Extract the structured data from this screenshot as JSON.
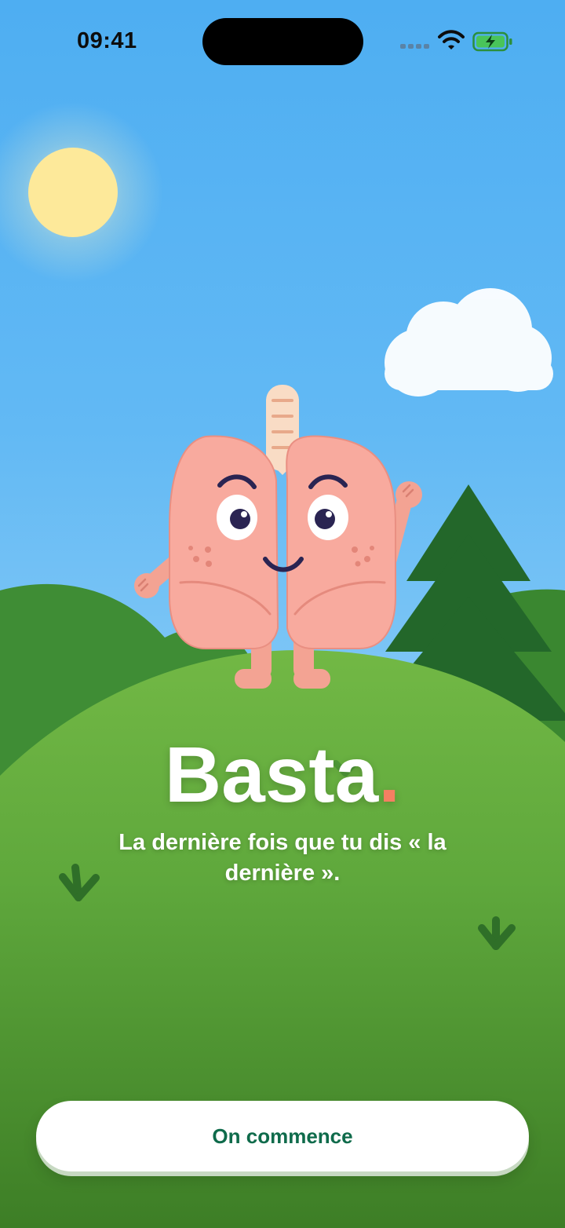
{
  "status_bar": {
    "time": "09:41",
    "icons": [
      "cellular-signal-icon",
      "wifi-icon",
      "battery-charging-icon"
    ]
  },
  "illustration": {
    "elements": [
      "sun",
      "cloud",
      "hills",
      "pine-tree",
      "lungs-mascot",
      "grass-tufts"
    ],
    "mascot": "smiling-lungs-character-waving"
  },
  "brand": {
    "name": "Basta",
    "dot": "."
  },
  "tagline": "La dernière fois que tu dis « la dernière ».",
  "cta": {
    "label": "On commence"
  },
  "colors": {
    "sky_top": "#4eaef2",
    "sky_bottom": "#9dd3f5",
    "sun": "#fde99a",
    "hill_front": "#6ab344",
    "hill_back": "#3a8a34",
    "tree": "#23672a",
    "lungs": "#f8aa9e",
    "accent_dot": "#f47f62",
    "cta_text": "#0f6b4b",
    "cta_background": "#ffffff"
  }
}
